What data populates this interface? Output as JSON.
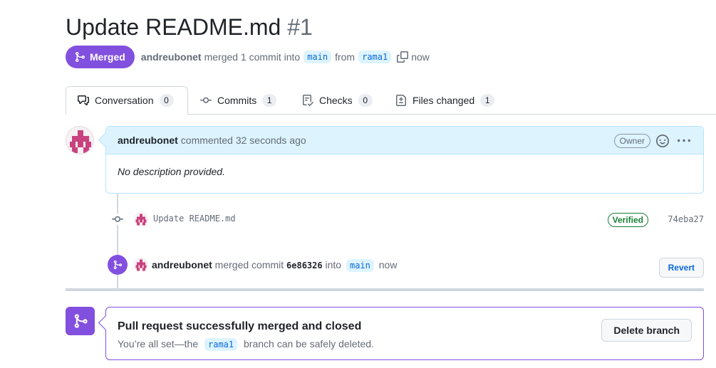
{
  "pr": {
    "title": "Update README.md",
    "number": "#1",
    "state": "Merged",
    "author": "andreubonet",
    "action_text": "merged 1 commit into",
    "base_branch": "main",
    "from_text": "from",
    "head_branch": "rama1",
    "time": "now"
  },
  "tabs": [
    {
      "label": "Conversation",
      "count": "0",
      "icon": "comment-discussion-icon",
      "active": true
    },
    {
      "label": "Commits",
      "count": "1",
      "icon": "git-commit-icon",
      "active": false
    },
    {
      "label": "Checks",
      "count": "0",
      "icon": "checklist-icon",
      "active": false
    },
    {
      "label": "Files changed",
      "count": "1",
      "icon": "file-diff-icon",
      "active": false
    }
  ],
  "comment": {
    "author": "andreubonet",
    "action": "commented 32 seconds ago",
    "role_badge": "Owner",
    "body": "No description provided."
  },
  "commit": {
    "message": "Update README.md",
    "verified": "Verified",
    "sha": "74eba27"
  },
  "merge_event": {
    "author": "andreubonet",
    "action": "merged commit",
    "sha": "6e86326",
    "into": "into",
    "branch": "main",
    "time": "now",
    "revert_label": "Revert"
  },
  "merge_box": {
    "title": "Pull request successfully merged and closed",
    "sub_prefix": "You’re all set—the",
    "branch": "rama1",
    "sub_suffix": "branch can be safely deleted.",
    "delete_label": "Delete branch"
  },
  "colors": {
    "merged_purple": "#8250df",
    "link_blue": "#0969da",
    "verified_green": "#1a7f37",
    "comment_header_bg": "#ddf4ff"
  }
}
